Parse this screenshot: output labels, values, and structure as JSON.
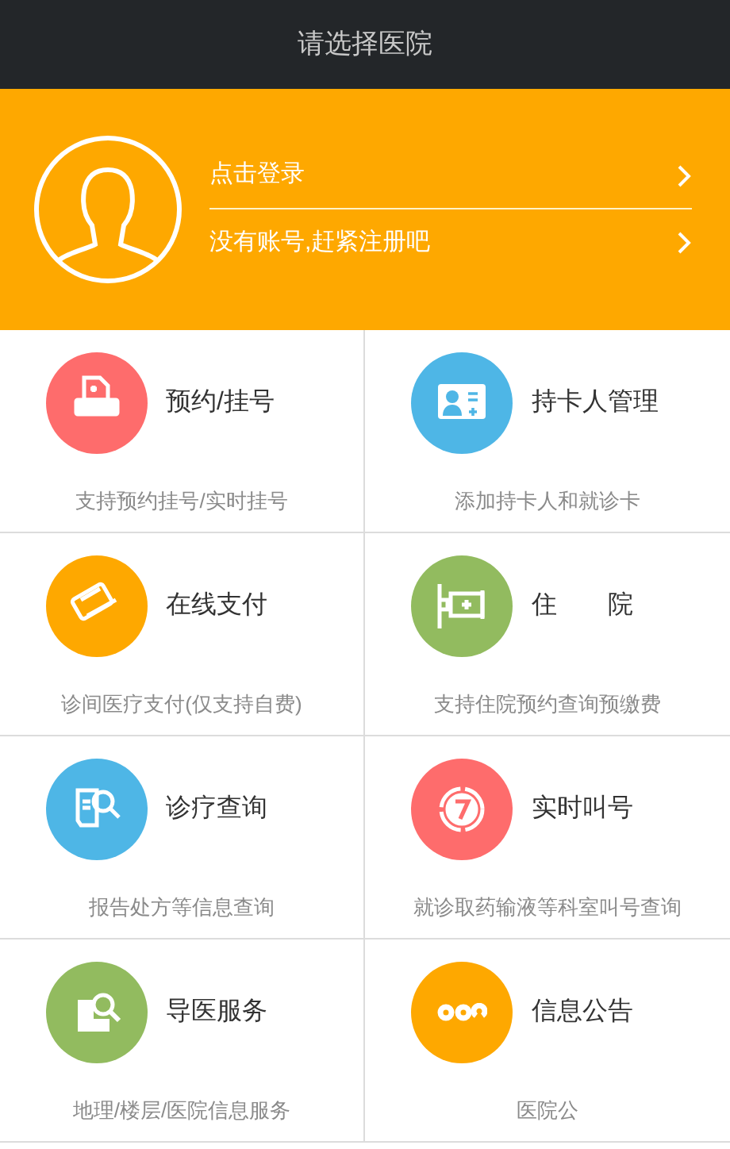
{
  "header": {
    "title": "请选择医院"
  },
  "login": {
    "items": [
      {
        "label": "点击登录"
      },
      {
        "label": "没有账号,赶紧注册吧"
      }
    ]
  },
  "services": [
    {
      "title": "预约/挂号",
      "description": "支持预约挂号/实时挂号",
      "color": "#fe6c6c"
    },
    {
      "title": "持卡人管理",
      "description": "添加持卡人和就诊卡",
      "color": "#4eb6e6"
    },
    {
      "title": "在线支付",
      "description": "诊间医疗支付(仅支持自费)",
      "color": "#fea800"
    },
    {
      "title": "住　　院",
      "description": "支持住院预约查询预缴费",
      "color": "#92bb5f"
    },
    {
      "title": "诊疗查询",
      "description": "报告处方等信息查询",
      "color": "#4eb6e6"
    },
    {
      "title": "实时叫号",
      "description": "就诊取药输液等科室叫号查询",
      "color": "#fe6c6c"
    },
    {
      "title": "导医服务",
      "description": "地理/楼层/医院信息服务",
      "color": "#92bb5f"
    },
    {
      "title": "信息公告",
      "description": "医院公",
      "color": "#fea800"
    }
  ]
}
